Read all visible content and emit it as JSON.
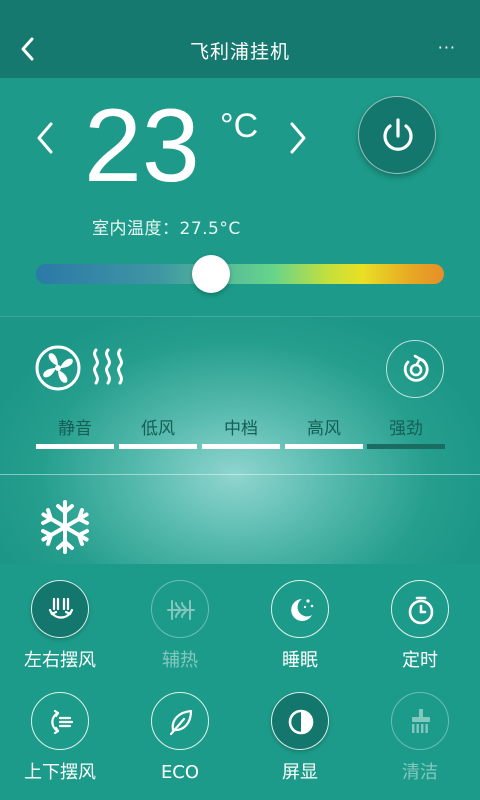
{
  "header": {
    "title": "飞利浦挂机",
    "back_icon": "chevron-left-icon",
    "more_label": "···"
  },
  "temperature": {
    "value": "23",
    "unit": "°C",
    "indoor_label": "室内温度：",
    "indoor_value": "27.5°C",
    "slider_level": 0.43
  },
  "mode": {
    "icons": [
      "fan-icon",
      "heat-waves-icon",
      "rotate-icon"
    ],
    "speeds": [
      {
        "label": "静音",
        "active": true
      },
      {
        "label": "低风",
        "active": true
      },
      {
        "label": "中档",
        "active": true
      },
      {
        "label": "高风",
        "active": true
      },
      {
        "label": "强劲",
        "active": false
      }
    ],
    "current_mode_icon": "snowflake-icon"
  },
  "functions": [
    {
      "label": "左右摆风",
      "icon": "swing-horizontal-icon",
      "state": "active"
    },
    {
      "label": "辅热",
      "icon": "aux-heat-icon",
      "state": "disabled"
    },
    {
      "label": "睡眠",
      "icon": "sleep-moon-icon",
      "state": "normal"
    },
    {
      "label": "定时",
      "icon": "timer-icon",
      "state": "normal"
    },
    {
      "label": "上下摆风",
      "icon": "swing-vertical-icon",
      "state": "normal"
    },
    {
      "label": "ECO",
      "icon": "leaf-icon",
      "state": "normal"
    },
    {
      "label": "屏显",
      "icon": "display-icon",
      "state": "active"
    },
    {
      "label": "清洁",
      "icon": "clean-brush-icon",
      "state": "disabled"
    }
  ],
  "colors": {
    "header": "#15796f",
    "background": "#1d9b8a",
    "active_button": "#14776d",
    "speed_label": "#155f56"
  }
}
